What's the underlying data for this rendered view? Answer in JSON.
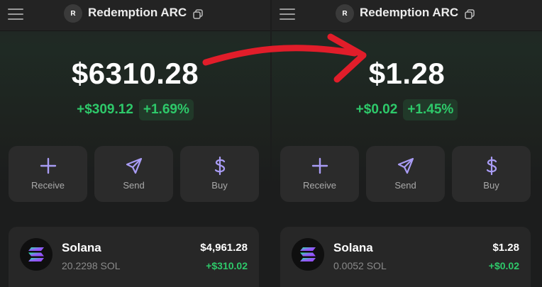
{
  "colors": {
    "background": "#1c1d1d",
    "positive": "#2ec96a",
    "accent_icon": "#a99cf5",
    "annotation_arrow": "#e11d2a"
  },
  "screens": [
    {
      "header": {
        "menu_icon": "hamburger-menu-icon",
        "avatar_initial": "R",
        "account_name": "Redemption ARC",
        "copy_icon": "copy-icon"
      },
      "balance": "$6310.28",
      "change": {
        "amount": "+$309.12",
        "percent": "+1.69%"
      },
      "actions": [
        {
          "label": "Receive",
          "icon": "plus-icon"
        },
        {
          "label": "Send",
          "icon": "send-icon"
        },
        {
          "label": "Buy",
          "icon": "dollar-icon"
        }
      ],
      "token": {
        "name": "Solana",
        "quantity": "20.2298 SOL",
        "value": "$4,961.28",
        "change": "+$310.02",
        "icon": "solana-logo-icon"
      }
    },
    {
      "header": {
        "menu_icon": "hamburger-menu-icon",
        "avatar_initial": "R",
        "account_name": "Redemption ARC",
        "copy_icon": "copy-icon"
      },
      "balance": "$1.28",
      "change": {
        "amount": "+$0.02",
        "percent": "+1.45%"
      },
      "actions": [
        {
          "label": "Receive",
          "icon": "plus-icon"
        },
        {
          "label": "Send",
          "icon": "send-icon"
        },
        {
          "label": "Buy",
          "icon": "dollar-icon"
        }
      ],
      "token": {
        "name": "Solana",
        "quantity": "0.0052 SOL",
        "value": "$1.28",
        "change": "+$0.02",
        "icon": "solana-logo-icon"
      }
    }
  ],
  "annotation": {
    "icon": "red-arrow-icon"
  }
}
